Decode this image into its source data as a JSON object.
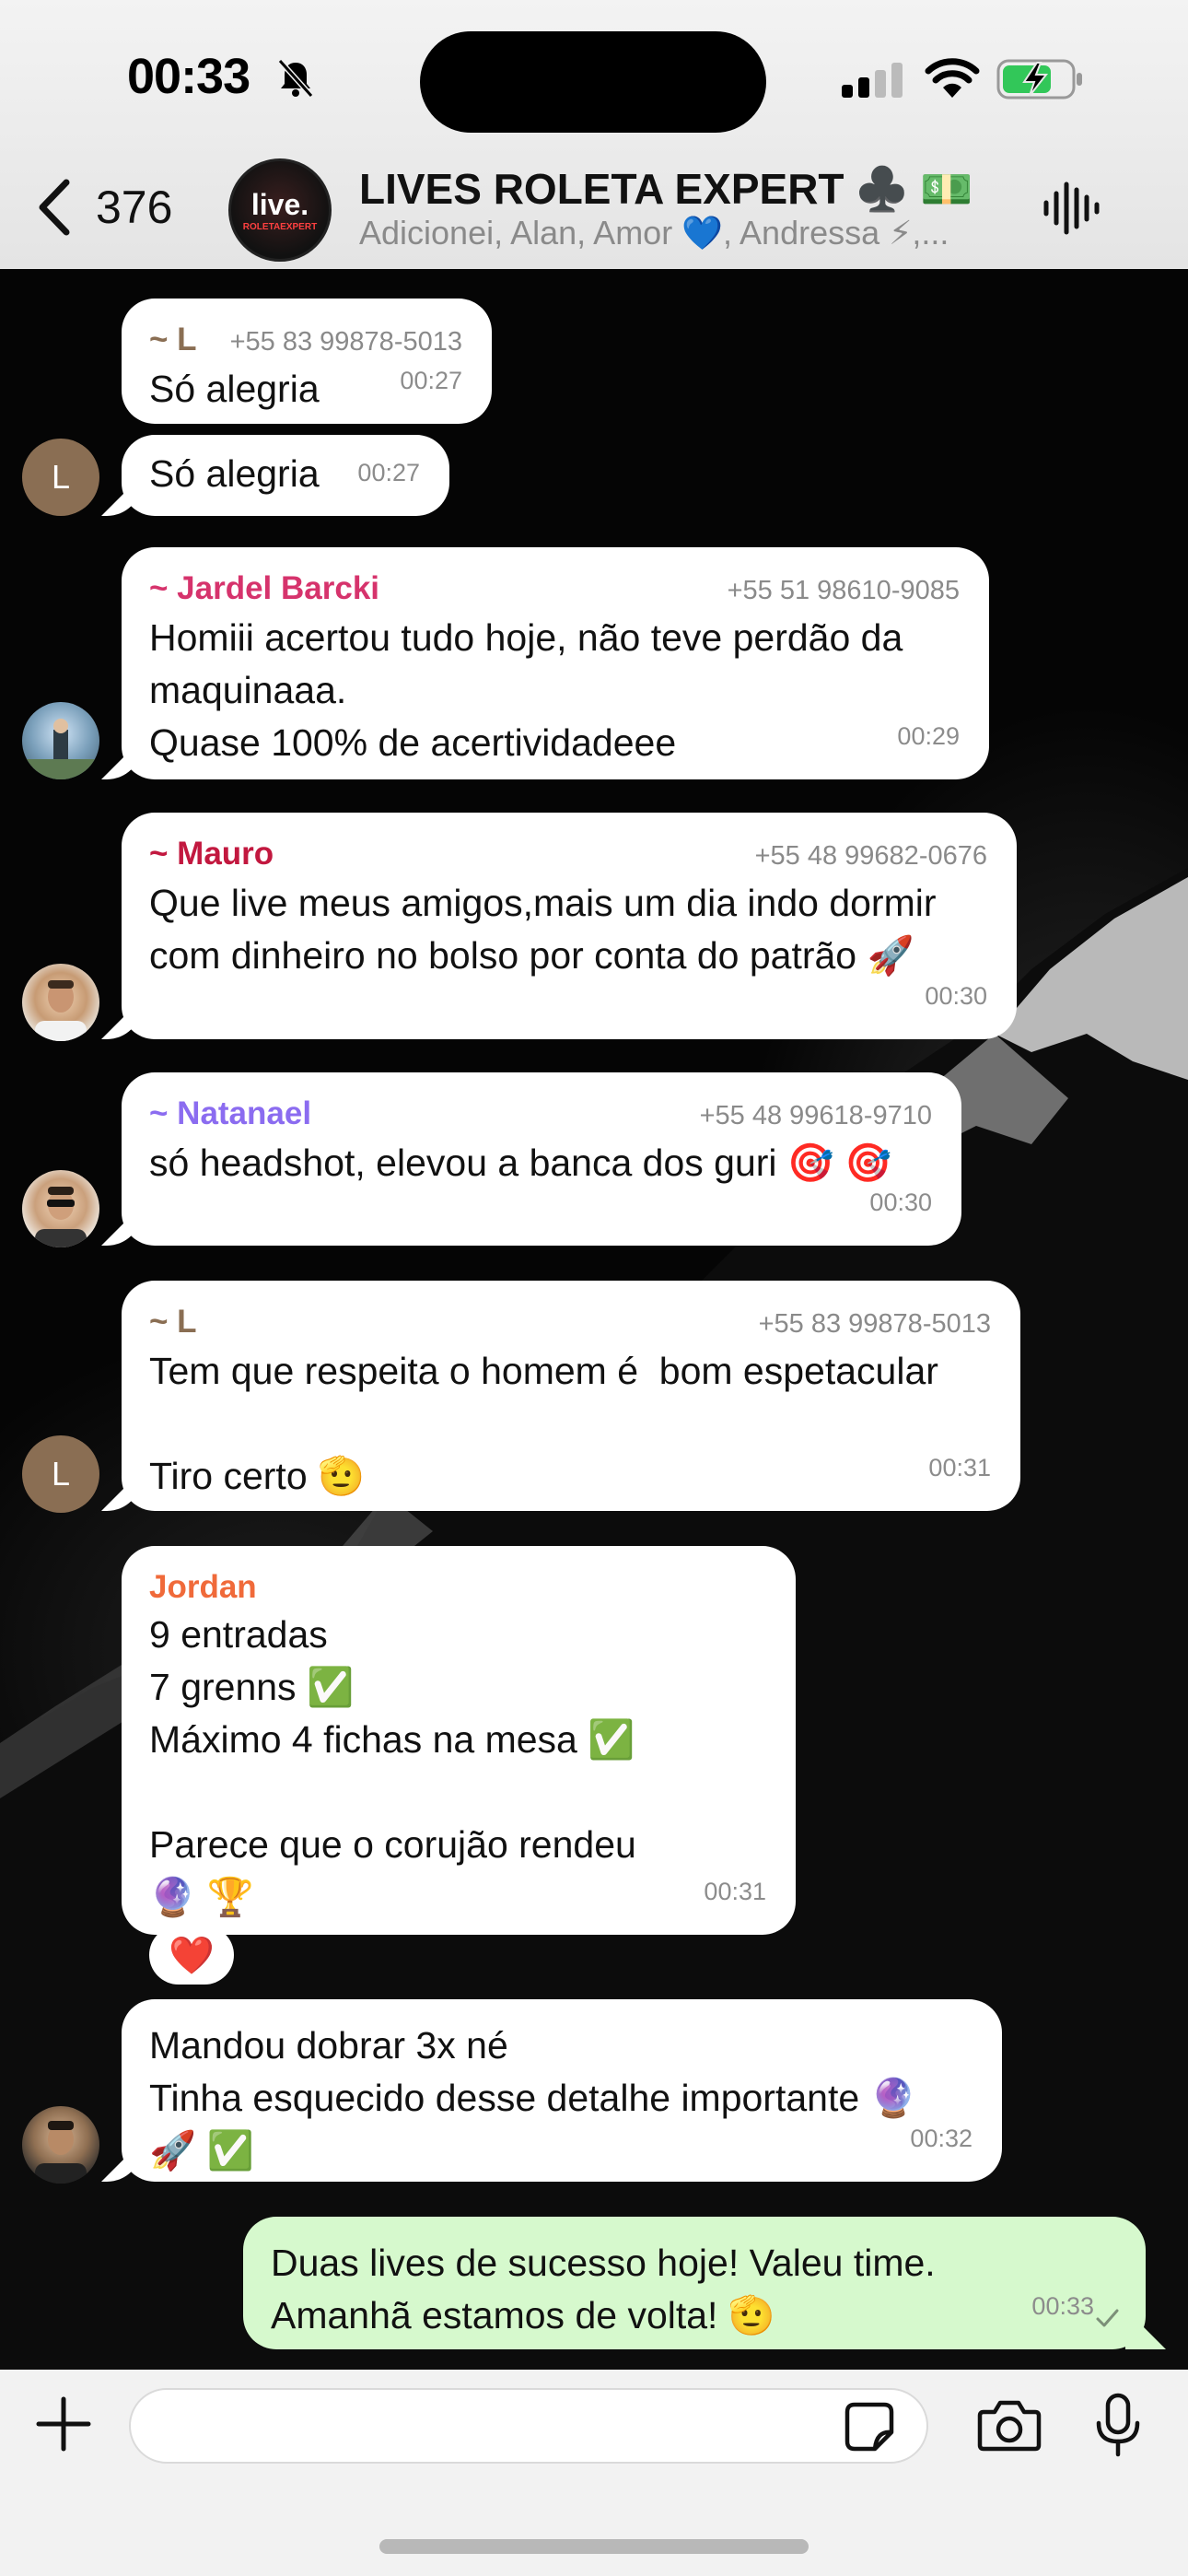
{
  "status_bar": {
    "time": "00:33"
  },
  "header": {
    "back_count": "376",
    "group_avatar_text": "live.",
    "group_avatar_sub": "ROLETAEXPERT",
    "title": "LIVES ROLETA EXPERT ♣️ 💵",
    "members": "Adicionei, Alan, Amor 💙, Andressa ⚡,..."
  },
  "messages": [
    {
      "sender": "~ L",
      "phone": "+55 83 99878-5013",
      "text": "Só alegria",
      "time": "00:27",
      "sender_color": "#8a6e53"
    },
    {
      "avatar_letter": "L",
      "text": "Só alegria",
      "time": "00:27"
    },
    {
      "sender": "~ Jardel Barcki",
      "phone": "+55 51 98610-9085",
      "text": "Homiii acertou tudo hoje, não teve perdão da\nmaquinaaa.\nQuase 100% de acertividadeee",
      "time": "00:29",
      "sender_color": "#d6336c"
    },
    {
      "sender": "~ Mauro",
      "phone": "+55 48 99682-0676",
      "text": "Que live meus amigos,mais um dia indo dormir\ncom dinheiro no bolso por conta do patrão 🚀",
      "time": "00:30",
      "sender_color": "#c2183f"
    },
    {
      "sender": "~ Natanael",
      "phone": "+55 48 99618-9710",
      "text": "só headshot, elevou a banca dos guri 🎯 🎯",
      "time": "00:30",
      "sender_color": "#8b6cf0"
    },
    {
      "sender": "~ L",
      "phone": "+55 83 99878-5013",
      "avatar_letter": "L",
      "text": "Tem que respeita o homem é  bom espetacular\n\nTiro certo 🫡",
      "time": "00:31",
      "sender_color": "#8a6e53"
    },
    {
      "sender": "Jordan",
      "text": "9 entradas\n7 grenns ✅\nMáximo 4 fichas na mesa ✅\n\nParece que o corujão rendeu\n🔮 🏆",
      "time": "00:31",
      "sender_color": "#f06a3a",
      "reaction": "❤️"
    },
    {
      "text": "Mandou dobrar 3x né\nTinha esquecido desse detalhe importante 🔮\n🚀 ✅",
      "time": "00:32"
    }
  ],
  "own_message": {
    "text": "Duas lives de sucesso hoje! Valeu time.\nAmanhã estamos de volta! 🫡",
    "time": "00:33"
  },
  "composer": {
    "placeholder": ""
  }
}
